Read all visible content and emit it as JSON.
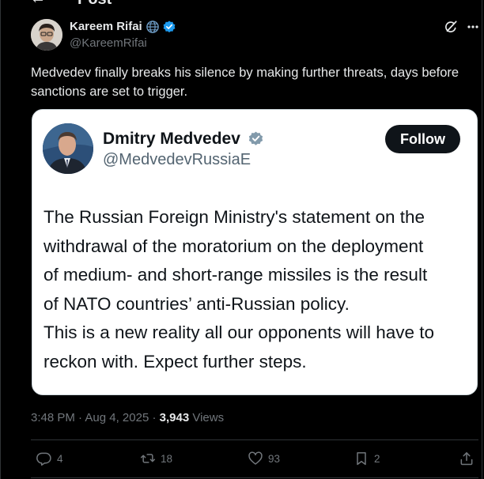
{
  "topbar": {
    "title": "Post"
  },
  "post": {
    "author": {
      "name": "Kareem Rifai",
      "handle": "@KareemRifai"
    },
    "text": "Medvedev finally breaks his silence by making further threats, days before sanctions are set to trigger.",
    "meta": {
      "time": "3:48 PM",
      "date": "Aug 4, 2025",
      "views_count": "3,943",
      "views_label": "Views"
    },
    "actions": {
      "replies": "4",
      "reposts": "18",
      "likes": "93",
      "bookmarks": "2"
    }
  },
  "quoted_card": {
    "name": "Dmitry Medvedev",
    "handle": "@MedvedevRussiaE",
    "follow_label": "Follow",
    "lines": [
      "The Russian Foreign Ministry's statement on the",
      "withdrawal of the moratorium on the deployment",
      "of medium- and short-range missiles is the result",
      "of NATO countries’ anti-Russian policy.",
      "This is a new reality all our opponents will have to",
      "reckon with. Expect further steps."
    ]
  },
  "colors": {
    "background": "#000000",
    "text_primary": "#e7e9ea",
    "text_secondary": "#71767b",
    "verified_blue": "#1d9bf0",
    "card_background": "#ffffff",
    "card_text": "#0f1419",
    "follow_button": "#0f1419"
  },
  "icons": [
    "back-arrow-icon",
    "globe-icon",
    "verified-badge-icon",
    "grok-icon",
    "more-icon",
    "reply-icon",
    "retweet-icon",
    "like-icon",
    "bookmark-icon",
    "share-icon"
  ]
}
